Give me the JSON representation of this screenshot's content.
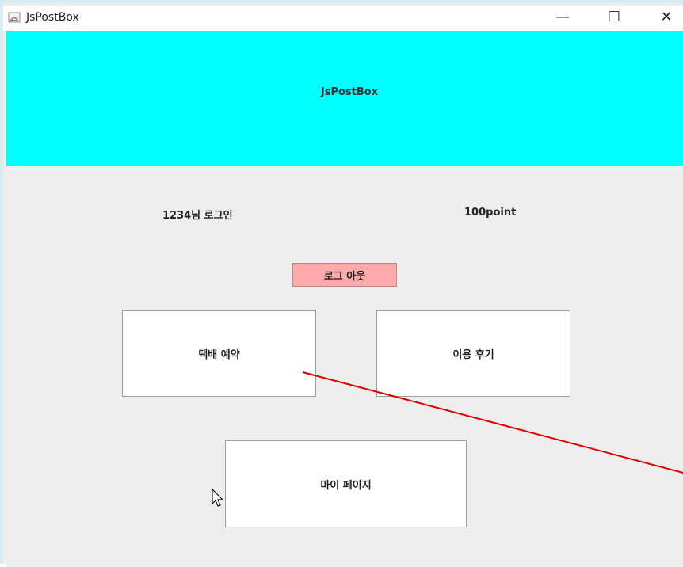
{
  "window": {
    "title": "JsPostBox",
    "minimize_symbol": "—",
    "maximize_symbol": "☐",
    "close_symbol": "✕"
  },
  "header": {
    "title": "JsPostBox",
    "background": "#00ffff"
  },
  "status": {
    "user": "1234님 로그인",
    "points": "100point"
  },
  "buttons": {
    "logout": "로그 아웃",
    "logout_color": "#ffaaaa",
    "reserve": "택배 예약",
    "review": "이용 후기",
    "mypage": "마이 페이지"
  },
  "icons": {
    "app": "java-app-icon",
    "cursor": "mouse-pointer-icon"
  },
  "annotation_color": "#e00000"
}
